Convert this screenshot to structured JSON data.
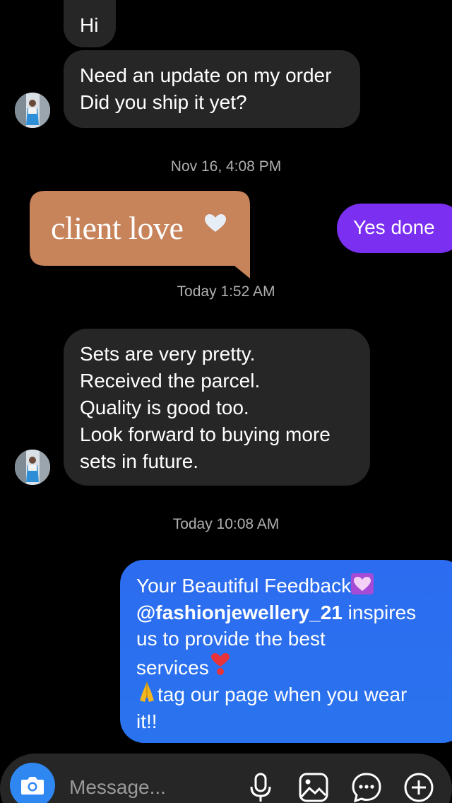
{
  "messages": [
    {
      "id": "m1",
      "sender": "customer",
      "text": "Hi"
    },
    {
      "id": "m2",
      "sender": "customer",
      "lines": [
        "Need an update on my order",
        "Did you ship it yet?"
      ]
    },
    {
      "id": "ts1",
      "type": "timestamp",
      "text": "Nov 16, 4:08 PM"
    },
    {
      "id": "m3",
      "sender": "shop",
      "type": "image",
      "caption": "client love"
    },
    {
      "id": "m4",
      "sender": "shop",
      "text": "Yes done"
    },
    {
      "id": "ts2",
      "type": "timestamp",
      "text": "Today 1:52 AM"
    },
    {
      "id": "m5",
      "sender": "customer",
      "lines": [
        "Sets are very pretty.",
        "Received the parcel.",
        "Quality is good too.",
        "Look forward to buying more",
        "sets in future."
      ]
    },
    {
      "id": "ts3",
      "type": "timestamp",
      "text": "Today 10:08 AM"
    },
    {
      "id": "m6",
      "sender": "shop",
      "lines": [
        "Your Beautiful Feedback",
        "@fashionjewellery_21",
        " inspires",
        "us to provide the best",
        "services",
        "tag our page when you wear",
        "it!!"
      ]
    }
  ],
  "composer": {
    "placeholder": "Message..."
  },
  "icons": {
    "camera": "camera-icon",
    "mic": "microphone-icon",
    "gallery": "gallery-icon",
    "sticker": "sticker-icon",
    "add": "plus-circle-icon",
    "heart_purple": "purple-heart-emoji",
    "heart_red": "red-heart-emoji",
    "pray": "folded-hands-emoji"
  },
  "colors": {
    "background": "#000000",
    "incoming_bubble": "#262626",
    "outgoing_purple": "#7b2ff0",
    "outgoing_blue": "#2c6cf0",
    "client_love_card": "#c7835a",
    "camera_button": "#2f87f2",
    "timestamp": "#b0b0b0"
  }
}
